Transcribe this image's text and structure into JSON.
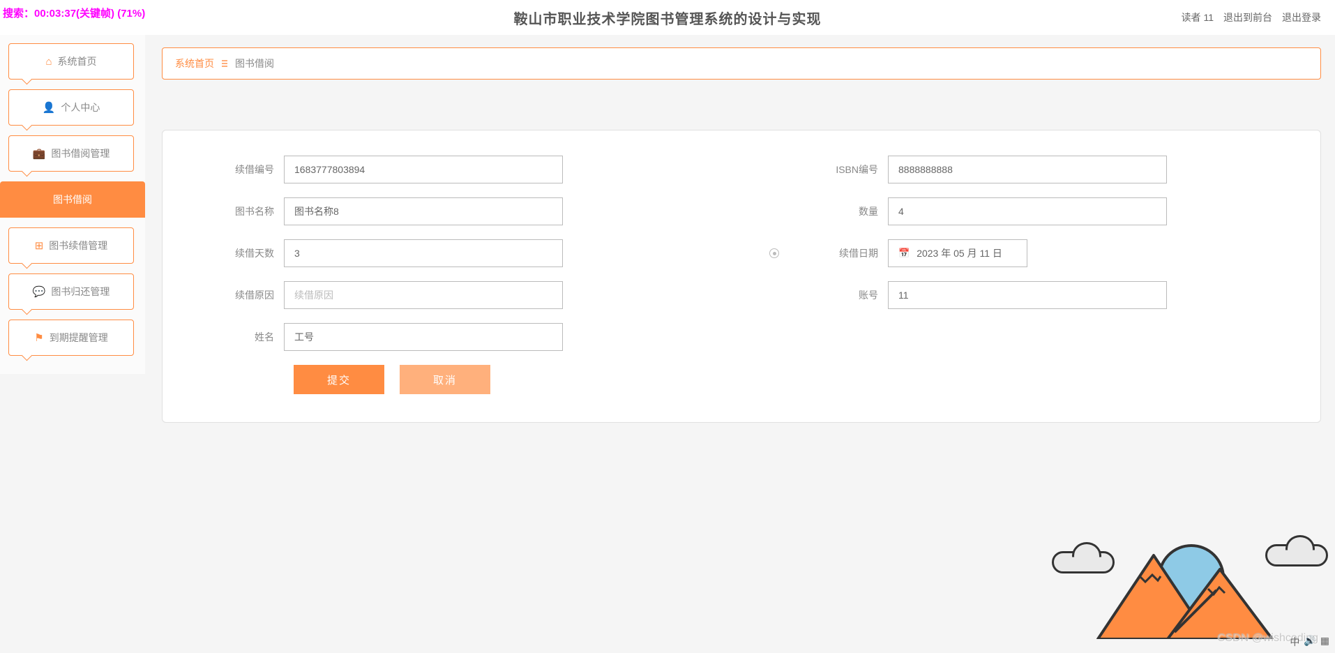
{
  "overlay": {
    "text": "搜索：00:03:37(关键帧) (71%)"
  },
  "header": {
    "title": "鞍山市职业技术学院图书管理系统的设计与实现",
    "user_label": "读者 11",
    "front_link": "退出到前台",
    "logout_link": "退出登录"
  },
  "sidebar": {
    "items": [
      {
        "label": "系统首页",
        "icon": "⌂"
      },
      {
        "label": "个人中心",
        "icon": "👤"
      },
      {
        "label": "图书借阅管理",
        "icon": "💼"
      },
      {
        "label": "图书借阅",
        "icon": ""
      },
      {
        "label": "图书续借管理",
        "icon": "⊞"
      },
      {
        "label": "图书归还管理",
        "icon": "💬"
      },
      {
        "label": "到期提醒管理",
        "icon": "⚑"
      }
    ]
  },
  "breadcrumb": {
    "home": "系统首页",
    "current": "图书借阅"
  },
  "form": {
    "labels": {
      "renew_no": "续借编号",
      "isbn": "ISBN编号",
      "book_name": "图书名称",
      "quantity": "数量",
      "renew_days": "续借天数",
      "renew_date": "续借日期",
      "renew_reason": "续借原因",
      "account": "账号",
      "name": "姓名"
    },
    "values": {
      "renew_no": "1683777803894",
      "isbn": "8888888888",
      "book_name": "图书名称8",
      "quantity": "4",
      "renew_days": "3",
      "renew_date": "2023 年 05 月 11 日",
      "renew_reason": "",
      "account": "11",
      "name": "工号"
    },
    "placeholders": {
      "renew_reason": "续借原因"
    },
    "buttons": {
      "submit": "提交",
      "cancel": "取消"
    }
  },
  "watermark": "CSDN @wishcoding"
}
